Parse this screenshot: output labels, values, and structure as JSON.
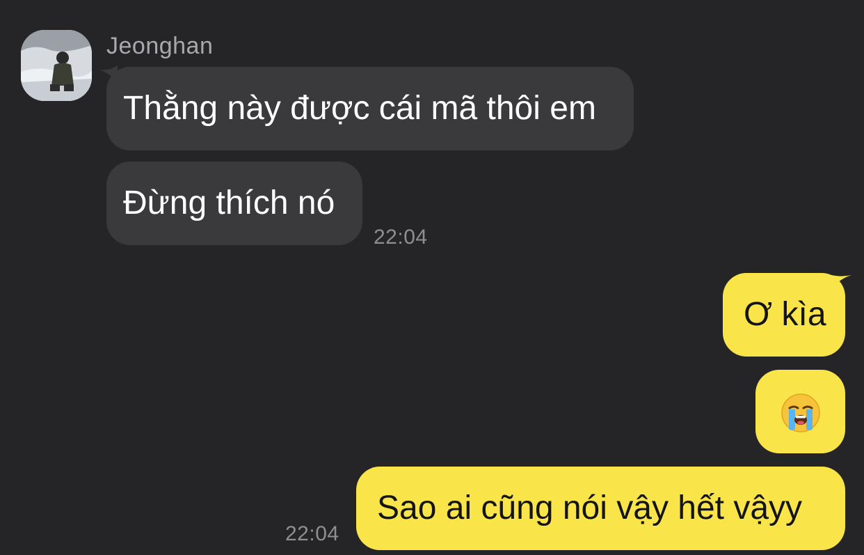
{
  "chat": {
    "incoming": {
      "sender": "Jeonghan",
      "messages": [
        "Thằng này được cái mã thôi em",
        "Đừng thích nó"
      ],
      "time": "22:04"
    },
    "outgoing": {
      "messages": [
        "Ơ kìa",
        "Sao ai cũng nói vậy hết vậyy"
      ],
      "emoji_message": "loudly-crying-face-emoji",
      "time": "22:04"
    },
    "colors": {
      "background": "#252527",
      "incoming_bubble": "#3a3a3d",
      "outgoing_bubble": "#f9e549",
      "timestamp": "#8f8f93"
    }
  }
}
